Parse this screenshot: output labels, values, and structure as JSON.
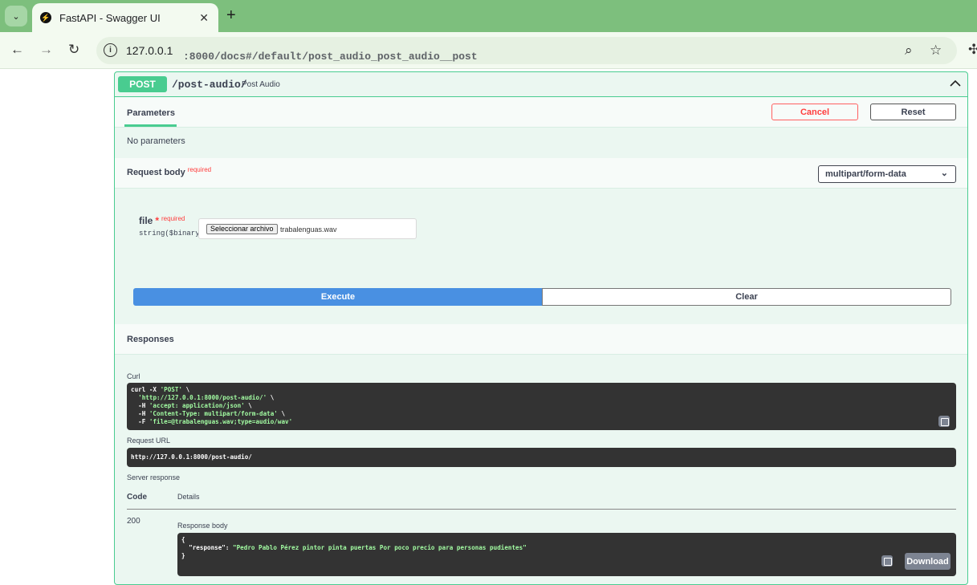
{
  "browser": {
    "tab_title": "FastAPI - Swagger UI",
    "favicon_glyph": "⚡",
    "url_host": "127.0.0.1",
    "url_path": ":8000/docs#/default/post_audio_post_audio__post"
  },
  "operation": {
    "method": "POST",
    "path": "/post-audio/",
    "summary": "Post Audio"
  },
  "parameters": {
    "tab_label": "Parameters",
    "cancel_label": "Cancel",
    "reset_label": "Reset",
    "no_params_text": "No parameters"
  },
  "request_body": {
    "label": "Request body",
    "required_label": "required",
    "content_type": "multipart/form-data",
    "field": {
      "name": "file",
      "required_star": "*",
      "required_label": "required",
      "type": "string($binary)",
      "choose_button": "Seleccionar archivo",
      "file_name": "trabalenguas.wav"
    }
  },
  "actions": {
    "execute_label": "Execute",
    "clear_label": "Clear"
  },
  "responses": {
    "title": "Responses",
    "curl_label": "Curl",
    "curl_lines": [
      {
        "prefix": "curl -X ",
        "str": "'POST'",
        "suffix": " \\"
      },
      {
        "prefix": "  ",
        "str": "'http://127.0.0.1:8000/post-audio/'",
        "suffix": " \\"
      },
      {
        "prefix": "  -H ",
        "str": "'accept: application/json'",
        "suffix": " \\"
      },
      {
        "prefix": "  -H ",
        "str": "'Content-Type: multipart/form-data'",
        "suffix": " \\"
      },
      {
        "prefix": "  -F ",
        "str": "'file=@trabalenguas.wav;type=audio/wav'",
        "suffix": ""
      }
    ],
    "request_url_label": "Request URL",
    "request_url": "http://127.0.0.1:8000/post-audio/",
    "server_response_label": "Server response",
    "code_header": "Code",
    "details_header": "Details",
    "code": "200",
    "response_body_label": "Response body",
    "response_body_open": "{",
    "response_key": "\"response\"",
    "response_value": "\"Pedro Pablo Pérez pintor pinta puertas Por poco precio para personas pudientes\"",
    "response_body_close": "}",
    "download_label": "Download"
  }
}
